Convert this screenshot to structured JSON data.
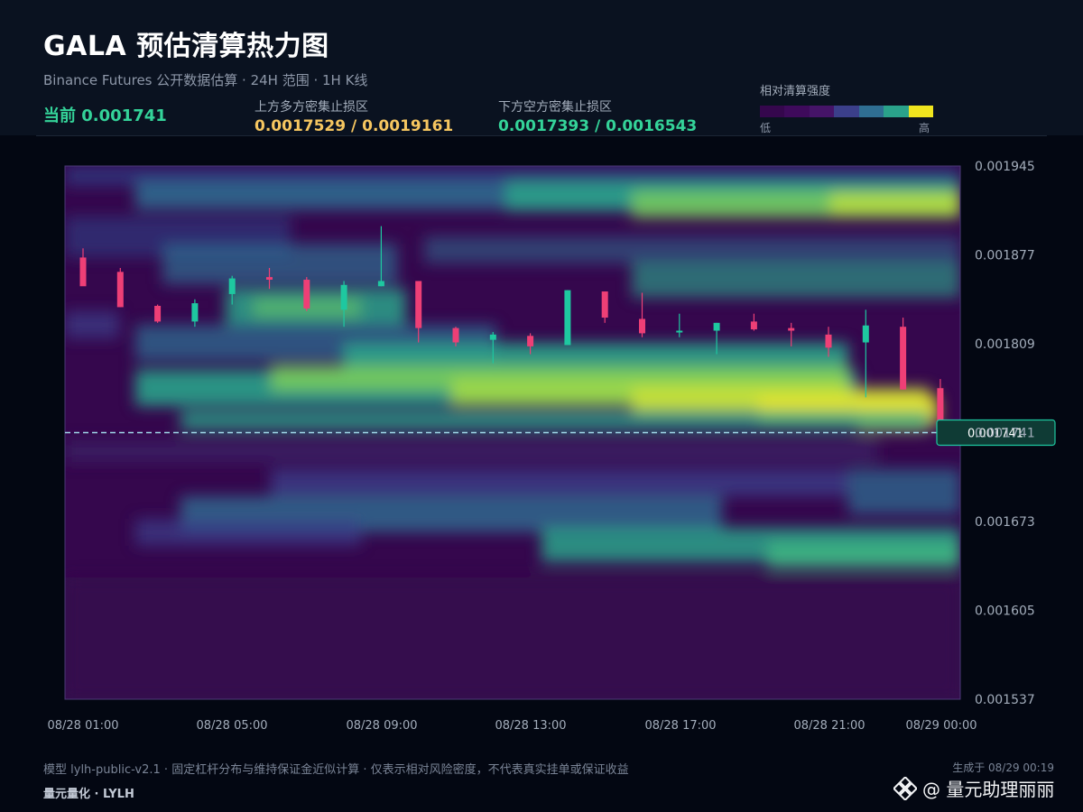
{
  "header": {
    "title": "GALA 预估清算热力图",
    "subtitle": "Binance Futures 公开数据估算 · 24H 范围 · 1H K线",
    "current_label": "当前 0.001741",
    "upper_zone": {
      "label": "上方多方密集止损区",
      "value": "0.0017529 / 0.0019161"
    },
    "lower_zone": {
      "label": "下方空方密集止损区",
      "value": "0.0017393 / 0.0016543"
    }
  },
  "legend": {
    "title": "相对清算强度",
    "low": "低",
    "high": "高",
    "colors": [
      "#35074d",
      "#3e0a5b",
      "#451468",
      "#3b3f8a",
      "#2f6e92",
      "#2aa28a",
      "#f0e51e"
    ]
  },
  "colors": {
    "up_candle": "#1ec8a0",
    "down_candle": "#ee3f76",
    "current_price_line": "#9fd8e8",
    "current_price_tag_bg": "#0f3b35",
    "current_price_tag_border": "#1ec8a0"
  },
  "chart_data": {
    "type": "heatmap",
    "x_ticks": [
      "08/28 01:00",
      "08/28 05:00",
      "08/28 09:00",
      "08/28 13:00",
      "08/28 17:00",
      "08/28 21:00",
      "08/29 00:00"
    ],
    "y_ticks": [
      "0.001945",
      "0.001877",
      "0.001809",
      "0.001741",
      "0.001673",
      "0.001605",
      "0.001537"
    ],
    "ylim": [
      0.001537,
      0.001945
    ],
    "current_price": 0.001741,
    "current_price_tag": "0.001741",
    "candles": [
      {
        "t": "08/28 01:00",
        "o": 0.001875,
        "h": 0.001882,
        "l": 0.001859,
        "c": 0.001853
      },
      {
        "t": "08/28 02:00",
        "o": 0.001864,
        "h": 0.001867,
        "l": 0.001837,
        "c": 0.001837
      },
      {
        "t": "08/28 03:00",
        "o": 0.001838,
        "h": 0.001839,
        "l": 0.001825,
        "c": 0.001826
      },
      {
        "t": "08/28 04:00",
        "o": 0.001826,
        "h": 0.001843,
        "l": 0.001822,
        "c": 0.00184
      },
      {
        "t": "08/28 05:00",
        "o": 0.001847,
        "h": 0.001861,
        "l": 0.001839,
        "c": 0.001859
      },
      {
        "t": "08/28 06:00",
        "o": 0.00186,
        "h": 0.001867,
        "l": 0.001851,
        "c": 0.001858
      },
      {
        "t": "08/28 07:00",
        "o": 0.001858,
        "h": 0.00186,
        "l": 0.001834,
        "c": 0.001836
      },
      {
        "t": "08/28 08:00",
        "o": 0.001835,
        "h": 0.001857,
        "l": 0.001822,
        "c": 0.001854
      },
      {
        "t": "08/28 09:00",
        "o": 0.001853,
        "h": 0.001899,
        "l": 0.001853,
        "c": 0.001857
      },
      {
        "t": "08/28 10:00",
        "o": 0.001857,
        "h": 0.001857,
        "l": 0.00181,
        "c": 0.001821
      },
      {
        "t": "08/28 11:00",
        "o": 0.001821,
        "h": 0.001822,
        "l": 0.001807,
        "c": 0.00181
      },
      {
        "t": "08/28 12:00",
        "o": 0.001812,
        "h": 0.001818,
        "l": 0.001794,
        "c": 0.001816
      },
      {
        "t": "08/28 13:00",
        "o": 0.001815,
        "h": 0.001817,
        "l": 0.001801,
        "c": 0.001807
      },
      {
        "t": "08/28 14:00",
        "o": 0.001808,
        "h": 0.00185,
        "l": 0.001808,
        "c": 0.00185
      },
      {
        "t": "08/28 15:00",
        "o": 0.001849,
        "h": 0.001849,
        "l": 0.001825,
        "c": 0.001829
      },
      {
        "t": "08/28 16:00",
        "o": 0.001828,
        "h": 0.001848,
        "l": 0.001814,
        "c": 0.001817
      },
      {
        "t": "08/28 17:00",
        "o": 0.001818,
        "h": 0.001832,
        "l": 0.001814,
        "c": 0.001819
      },
      {
        "t": "08/28 18:00",
        "o": 0.001819,
        "h": 0.001825,
        "l": 0.001801,
        "c": 0.001825
      },
      {
        "t": "08/28 19:00",
        "o": 0.001826,
        "h": 0.001832,
        "l": 0.001819,
        "c": 0.00182
      },
      {
        "t": "08/28 20:00",
        "o": 0.001821,
        "h": 0.001825,
        "l": 0.001807,
        "c": 0.001819
      },
      {
        "t": "08/28 21:00",
        "o": 0.001816,
        "h": 0.001822,
        "l": 0.001799,
        "c": 0.001806
      },
      {
        "t": "08/28 22:00",
        "o": 0.00181,
        "h": 0.001835,
        "l": 0.001768,
        "c": 0.001823
      },
      {
        "t": "08/28 23:00",
        "o": 0.001822,
        "h": 0.001829,
        "l": 0.001774,
        "c": 0.001774
      },
      {
        "t": "08/29 00:00",
        "o": 0.001775,
        "h": 0.001782,
        "l": 0.001741,
        "c": 0.001741
      }
    ]
  },
  "footer": {
    "note": "模型 lylh-public-v2.1 · 固定杠杆分布与维持保证金近似计算 · 仅表示相对风险密度，不代表真实挂单或保证收益",
    "generated": "生成于 08/29 00:19",
    "brand": "量元量化 · LYLH"
  },
  "watermark": {
    "text": "@ 量元助理丽丽"
  }
}
